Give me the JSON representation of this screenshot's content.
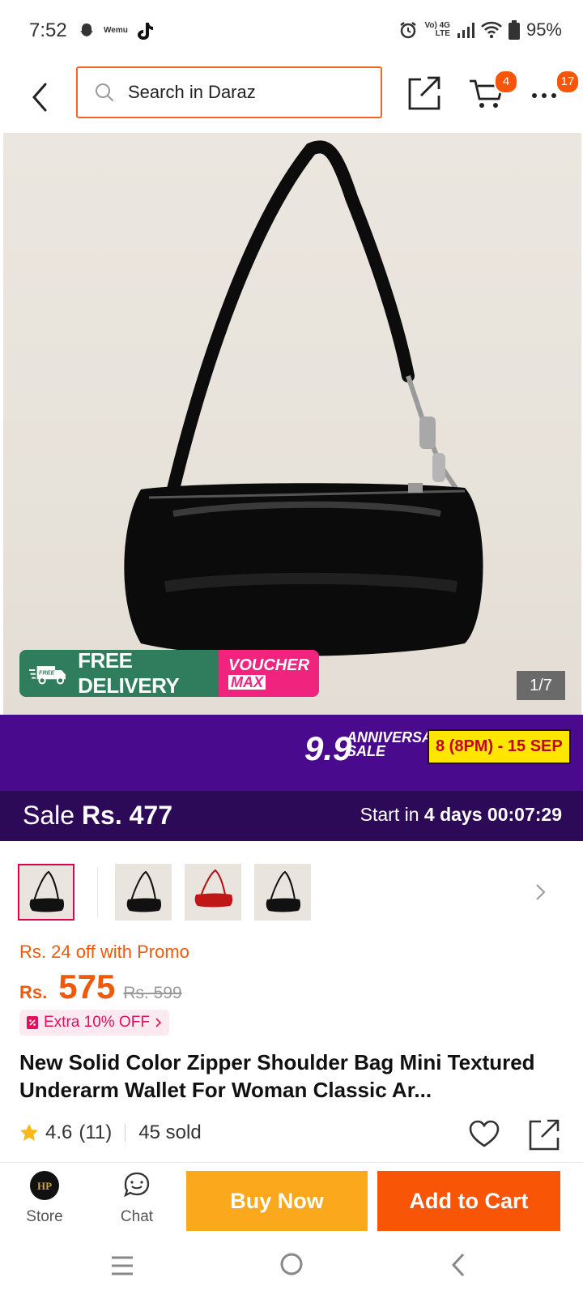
{
  "status_bar": {
    "time": "7:52",
    "left_icons": [
      "snapchat-icon",
      "wemu-icon",
      "tiktok-icon"
    ],
    "mini_app_label": "Wemu",
    "network_top": "Vo) 4G",
    "network_bottom": "LTE",
    "battery": "95%"
  },
  "header": {
    "search_placeholder": "Search in Daraz",
    "cart_count": "4",
    "more_count": "17"
  },
  "gallery": {
    "counter": "1/7",
    "free_badge": "FREE",
    "free_delivery": "FREE DELIVERY",
    "voucher_top": "VOUCHER",
    "voucher_bottom": "MAX"
  },
  "campaign": {
    "big": "9.9",
    "line1": "ANNIVERSARY",
    "line2": "SALE",
    "dates": "8 (8PM) - 15 SEP"
  },
  "sale": {
    "label": "Sale",
    "price": "Rs. 477",
    "start_prefix": "Start in",
    "start_days": "4 days",
    "timer": "00:07:29"
  },
  "thumbnails": [
    "black",
    "black",
    "red",
    "black"
  ],
  "pricing": {
    "promo": "Rs. 24 off with Promo",
    "currency": "Rs.",
    "price": "575",
    "original": "Rs. 599",
    "extra_off": "Extra 10% OFF"
  },
  "product": {
    "title": "New Solid Color Zipper Shoulder Bag Mini Textured Underarm Wallet For Woman Classic Ar...",
    "rating": "4.6",
    "reviews": "(11)",
    "sold": "45 sold"
  },
  "actions": {
    "store": "Store",
    "chat": "Chat",
    "buy_now": "Buy Now",
    "add_to_cart": "Add to Cart"
  },
  "colors": {
    "brand_orange": "#f85606",
    "buy_now_yellow": "#fca81c",
    "campaign_purple": "#4a0a8e",
    "free_delivery_green": "#2f7d5d",
    "voucher_pink": "#f0247e"
  }
}
